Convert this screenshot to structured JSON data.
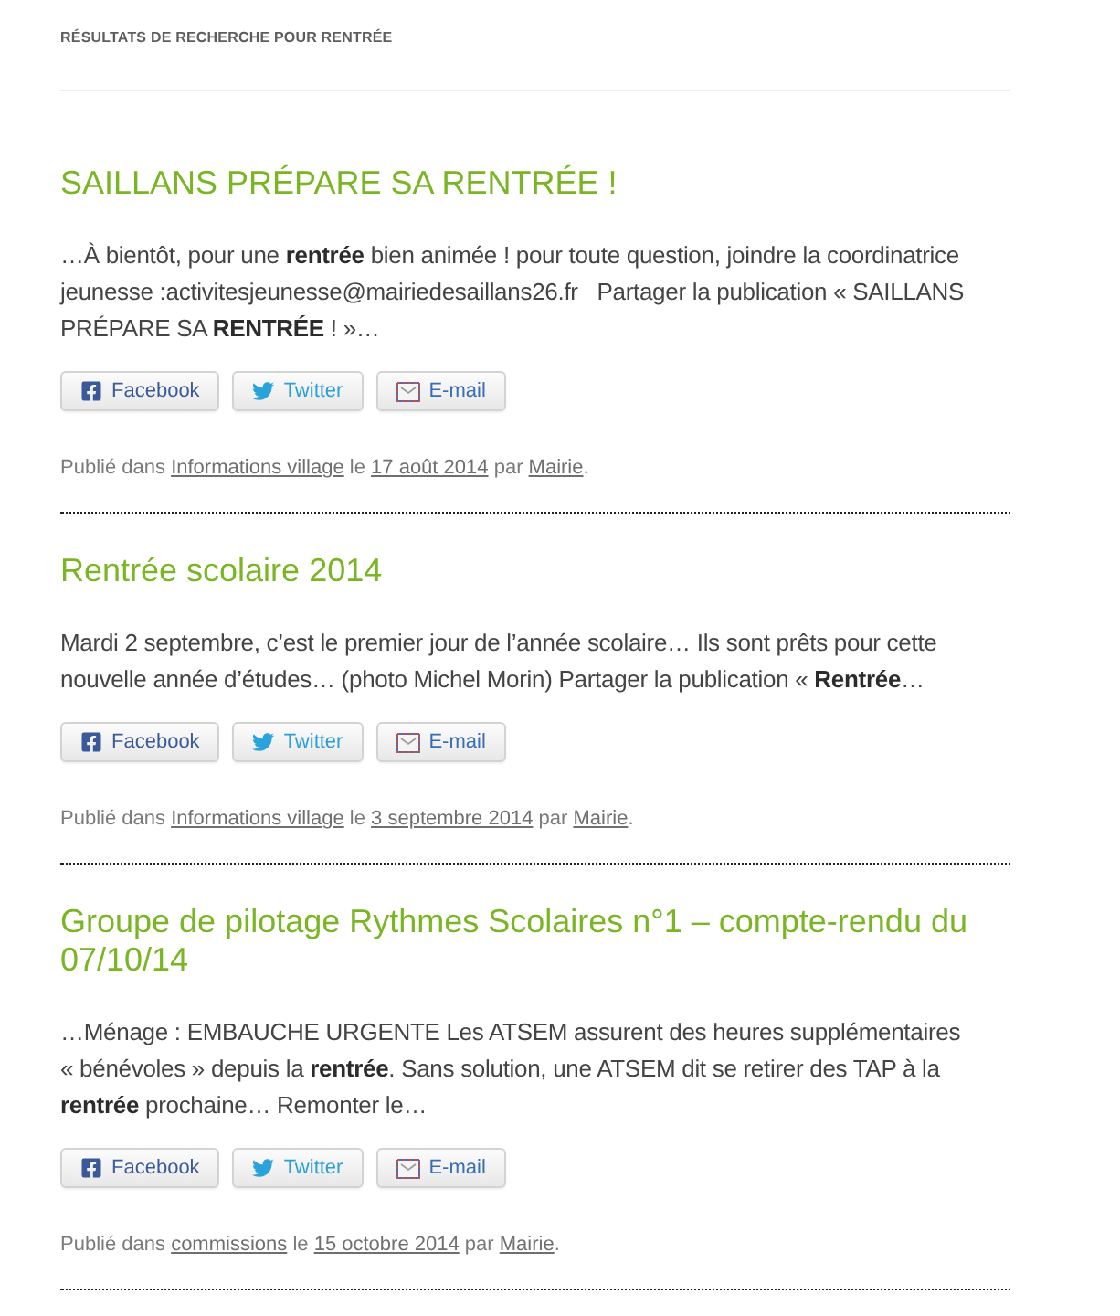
{
  "heading": "RÉSULTATS DE RECHERCHE POUR RENTRÉE",
  "posts": [
    {
      "title": "SAILLANS PRÉPARE SA RENTRÉE !",
      "excerpt": "…À bientôt, pour une **rentrée** bien animée ! pour toute question, joindre la coordinatrice jeunesse :activitesjeunesse@mairiedesaillans26.fr   Partager la publication « SAILLANS PRÉPARE SA **RENTRÉE** ! »…",
      "share_buttons": [
        {
          "kind": "facebook",
          "label": "Facebook"
        },
        {
          "kind": "twitter",
          "label": "Twitter"
        },
        {
          "kind": "email",
          "label": "E-mail"
        }
      ],
      "meta": {
        "prefix": "Publié dans",
        "category": "Informations village",
        "date_prefix": "le",
        "date": "17 août 2014",
        "author_prefix": "par",
        "author": "Mairie",
        "suffix": "."
      }
    },
    {
      "title": "Rentrée scolaire 2014",
      "excerpt": "Mardi 2 septembre, c’est le premier jour de l’année scolaire… Ils sont prêts pour cette nouvelle année d’études… (photo Michel Morin) Partager la publication « **Rentrée**…",
      "share_buttons": [
        {
          "kind": "facebook",
          "label": "Facebook"
        },
        {
          "kind": "twitter",
          "label": "Twitter"
        },
        {
          "kind": "email",
          "label": "E-mail"
        }
      ],
      "meta": {
        "prefix": "Publié dans",
        "category": "Informations village",
        "date_prefix": "le",
        "date": "3 septembre 2014",
        "author_prefix": "par",
        "author": "Mairie",
        "suffix": "."
      }
    },
    {
      "title": "Groupe de pilotage Rythmes Scolaires n°1 – compte-rendu du 07/10/14",
      "excerpt": "…Ménage : EMBAUCHE URGENTE Les ATSEM assurent des heures supplémentaires « bénévoles » depuis la **rentrée**. Sans solution, une ATSEM dit se retirer des TAP à la **rentrée** prochaine… Remonter le…",
      "share_buttons": [
        {
          "kind": "facebook",
          "label": "Facebook"
        },
        {
          "kind": "twitter",
          "label": "Twitter"
        },
        {
          "kind": "email",
          "label": "E-mail"
        }
      ],
      "meta": {
        "prefix": "Publié dans",
        "category": "commissions",
        "date_prefix": "le",
        "date": "15 octobre 2014",
        "author_prefix": "par",
        "author": "Mairie",
        "suffix": "."
      }
    }
  ]
}
